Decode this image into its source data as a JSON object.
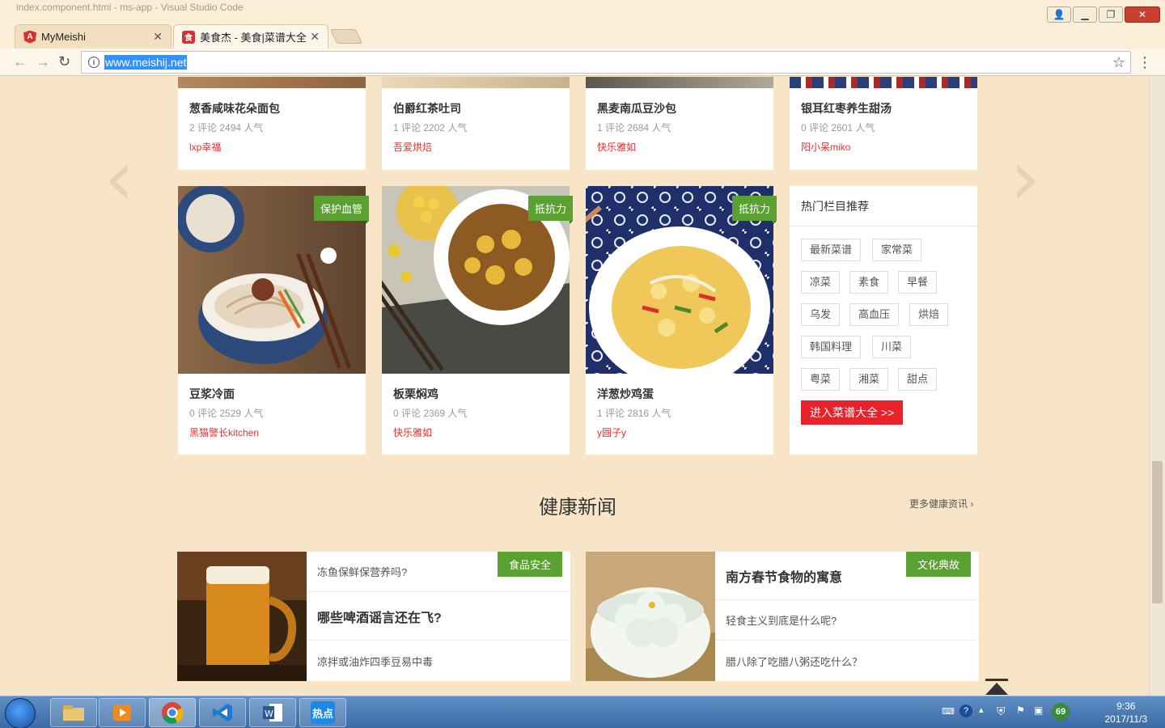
{
  "window": {
    "bg_title": "index.component.html - ms-app - Visual Studio Code",
    "tabs": [
      {
        "label": "MyMeishi",
        "favicon": "A"
      },
      {
        "label": "美食杰 - 美食|菜谱大全|",
        "favicon": "食"
      }
    ],
    "url": "www.meishij.net"
  },
  "recipes_top": [
    {
      "name": "葱香咸味花朵面包",
      "stats": "2 评论 2494 人气",
      "author": "lxp幸福"
    },
    {
      "name": "伯爵红茶吐司",
      "stats": "1 评论 2202 人气",
      "author": "吾爱烘焙"
    },
    {
      "name": "黑麦南瓜豆沙包",
      "stats": "1 评论 2684 人气",
      "author": "快乐雅如"
    },
    {
      "name": "银耳红枣养生甜汤",
      "stats": "0 评论 2601 人气",
      "author": "阳小呆miko"
    }
  ],
  "recipes_bottom": [
    {
      "name": "豆浆冷面",
      "stats": "0 评论 2529 人气",
      "author": "黑猫警长kitchen",
      "tag": "保护血管"
    },
    {
      "name": "板栗焖鸡",
      "stats": "0 评论 2369 人气",
      "author": "快乐雅如",
      "tag": "抵抗力"
    },
    {
      "name": "洋葱炒鸡蛋",
      "stats": "1 评论 2816 人气",
      "author": "y圆子y",
      "tag": "抵抗力"
    }
  ],
  "categories": {
    "title": "热门栏目推荐",
    "tags": [
      "最新菜谱",
      "家常菜",
      "凉菜",
      "素食",
      "早餐",
      "乌发",
      "高血压",
      "烘焙",
      "韩国料理",
      "川菜",
      "粤菜",
      "湘菜",
      "甜点"
    ],
    "cta": "进入菜谱大全 >>"
  },
  "health": {
    "title": "健康新闻",
    "more": "更多健康资讯",
    "left": {
      "tag": "食品安全",
      "items": [
        "冻鱼保鲜保营养吗?",
        "哪些啤酒谣言还在飞?",
        "凉拌或油炸四季豆易中毒"
      ]
    },
    "right": {
      "tag": "文化典故",
      "items": [
        "南方春节食物的寓意",
        "轻食主义到底是什么呢?",
        "腊八除了吃腊八粥还吃什么？"
      ]
    }
  },
  "taskbar": {
    "time": "9:36",
    "date": "2017/11/3",
    "badge": "69",
    "hot_app": "热点"
  },
  "colors": {
    "page_bg": "#f8e5c8",
    "accent_red": "#e8222a",
    "tag_green": "#5aa132"
  }
}
